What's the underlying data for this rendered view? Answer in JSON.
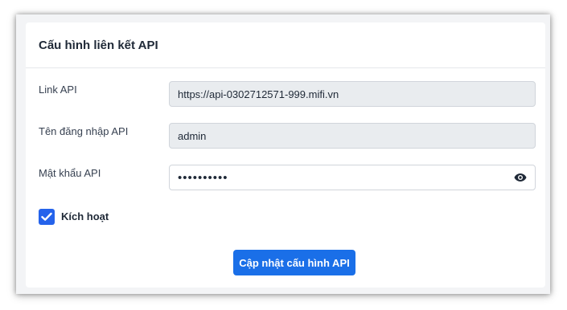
{
  "card": {
    "title": "Cấu hình liên kết API"
  },
  "fields": {
    "link_api": {
      "label": "Link API",
      "value": "https://api-0302712571-999.mifi.vn"
    },
    "username": {
      "label": "Tên đăng nhập API",
      "value": "admin"
    },
    "password": {
      "label": "Mật khẩu API",
      "masked_value": "••••••••••",
      "toggle_icon": "eye-icon"
    }
  },
  "activate": {
    "label": "Kích hoạt",
    "checked": true
  },
  "submit": {
    "label": "Cập nhật cấu hình API"
  },
  "colors": {
    "primary": "#1a6fe8",
    "checkbox": "#2563eb",
    "readonly_bg": "#e9ecef"
  }
}
